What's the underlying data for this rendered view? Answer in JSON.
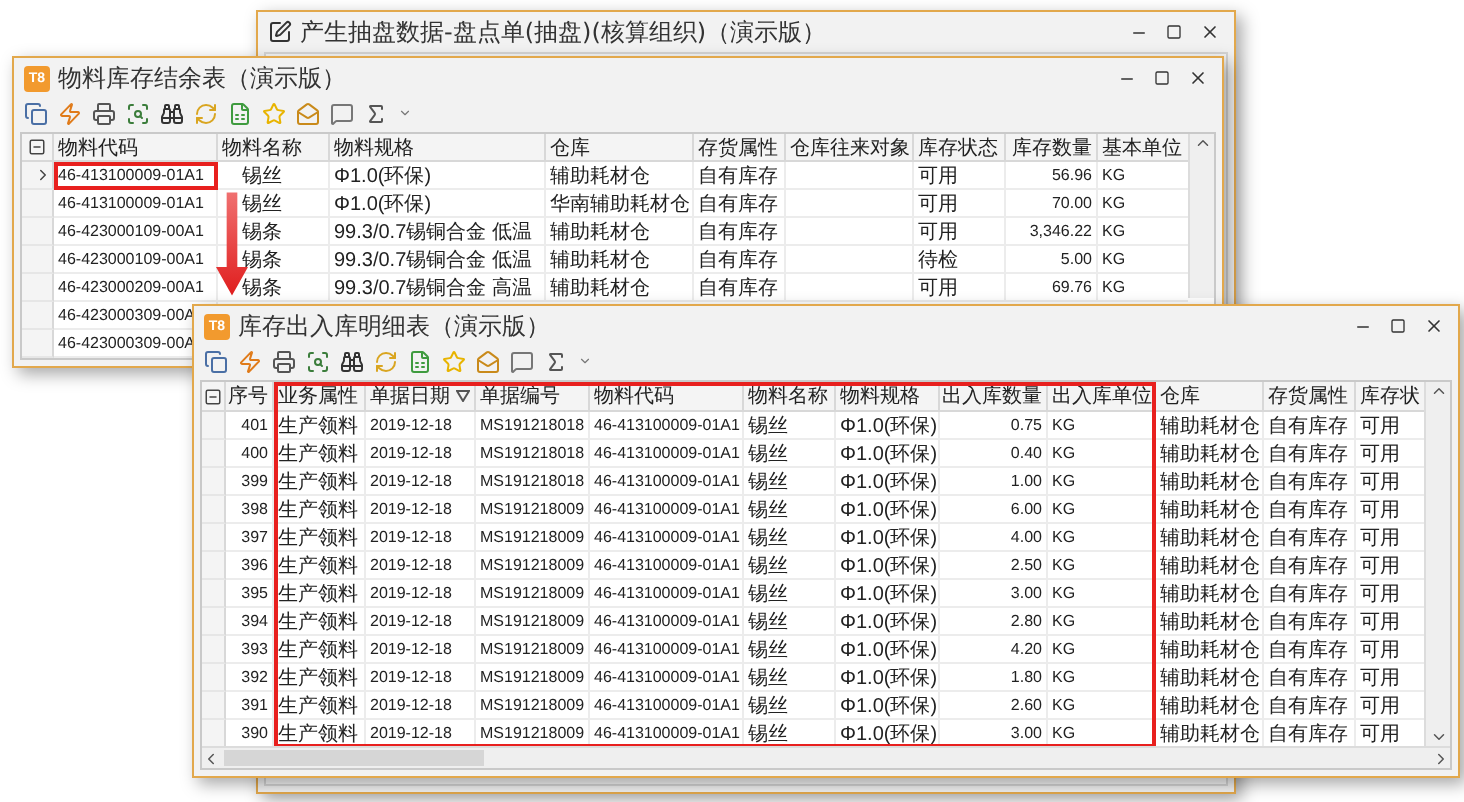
{
  "back_window": {
    "title": "产生抽盘数据-盘点单(抽盘)(核算组织)（演示版）"
  },
  "stock_window": {
    "badge": "T8",
    "title": "物料库存结余表（演示版）",
    "columns": [
      "物料代码",
      "物料名称",
      "物料规格",
      "仓库",
      "存货属性",
      "仓库往来对象",
      "库存状态",
      "库存数量",
      "基本单位"
    ],
    "rows": [
      {
        "current": true,
        "marked": true,
        "cells": [
          "46-413100009-01A1",
          "锡丝",
          "Φ1.0(环保)",
          "辅助耗材仓",
          "自有库存",
          "",
          "可用",
          "56.96",
          "KG"
        ]
      },
      {
        "current": false,
        "marked": false,
        "cells": [
          "46-413100009-01A1",
          "锡丝",
          "Φ1.0(环保)",
          "华南辅助耗材仓",
          "自有库存",
          "",
          "可用",
          "70.00",
          "KG"
        ]
      },
      {
        "current": false,
        "marked": false,
        "cells": [
          "46-423000109-00A1",
          "锡条",
          "99.3/0.7锡铜合金 低温",
          "辅助耗材仓",
          "自有库存",
          "",
          "可用",
          "3,346.22",
          "KG"
        ]
      },
      {
        "current": false,
        "marked": false,
        "cells": [
          "46-423000109-00A1",
          "锡条",
          "99.3/0.7锡铜合金 低温",
          "辅助耗材仓",
          "自有库存",
          "",
          "待检",
          "5.00",
          "KG"
        ]
      },
      {
        "current": false,
        "marked": false,
        "cells": [
          "46-423000209-00A1",
          "锡条",
          "99.3/0.7锡铜合金 高温",
          "辅助耗材仓",
          "自有库存",
          "",
          "可用",
          "69.76",
          "KG"
        ]
      },
      {
        "current": false,
        "marked": false,
        "cells": [
          "46-423000309-00A"
        ]
      },
      {
        "current": false,
        "marked": false,
        "cells": [
          "46-423000309-00A"
        ]
      }
    ]
  },
  "detail_window": {
    "badge": "T8",
    "title": "库存出入库明细表（演示版）",
    "framed": true,
    "columns": [
      {
        "label": "序号",
        "sorted": false
      },
      {
        "label": "业务属性",
        "sorted": false
      },
      {
        "label": "单据日期",
        "sorted": true
      },
      {
        "label": "单据编号",
        "sorted": false
      },
      {
        "label": "物料代码",
        "sorted": false
      },
      {
        "label": "物料名称",
        "sorted": false
      },
      {
        "label": "物料规格",
        "sorted": false
      },
      {
        "label": "出入库数量",
        "sorted": false
      },
      {
        "label": "出入库单位",
        "sorted": false
      },
      {
        "label": "仓库",
        "sorted": false
      },
      {
        "label": "存货属性",
        "sorted": false
      },
      {
        "label": "库存状",
        "sorted": false
      }
    ],
    "rows": [
      [
        "401",
        "生产领料",
        "2019-12-18",
        "MS191218018",
        "46-413100009-01A1",
        "锡丝",
        "Φ1.0(环保)",
        "0.75",
        "KG",
        "辅助耗材仓",
        "自有库存",
        "可用"
      ],
      [
        "400",
        "生产领料",
        "2019-12-18",
        "MS191218018",
        "46-413100009-01A1",
        "锡丝",
        "Φ1.0(环保)",
        "0.40",
        "KG",
        "辅助耗材仓",
        "自有库存",
        "可用"
      ],
      [
        "399",
        "生产领料",
        "2019-12-18",
        "MS191218018",
        "46-413100009-01A1",
        "锡丝",
        "Φ1.0(环保)",
        "1.00",
        "KG",
        "辅助耗材仓",
        "自有库存",
        "可用"
      ],
      [
        "398",
        "生产领料",
        "2019-12-18",
        "MS191218009",
        "46-413100009-01A1",
        "锡丝",
        "Φ1.0(环保)",
        "6.00",
        "KG",
        "辅助耗材仓",
        "自有库存",
        "可用"
      ],
      [
        "397",
        "生产领料",
        "2019-12-18",
        "MS191218009",
        "46-413100009-01A1",
        "锡丝",
        "Φ1.0(环保)",
        "4.00",
        "KG",
        "辅助耗材仓",
        "自有库存",
        "可用"
      ],
      [
        "396",
        "生产领料",
        "2019-12-18",
        "MS191218009",
        "46-413100009-01A1",
        "锡丝",
        "Φ1.0(环保)",
        "2.50",
        "KG",
        "辅助耗材仓",
        "自有库存",
        "可用"
      ],
      [
        "395",
        "生产领料",
        "2019-12-18",
        "MS191218009",
        "46-413100009-01A1",
        "锡丝",
        "Φ1.0(环保)",
        "3.00",
        "KG",
        "辅助耗材仓",
        "自有库存",
        "可用"
      ],
      [
        "394",
        "生产领料",
        "2019-12-18",
        "MS191218009",
        "46-413100009-01A1",
        "锡丝",
        "Φ1.0(环保)",
        "2.80",
        "KG",
        "辅助耗材仓",
        "自有库存",
        "可用"
      ],
      [
        "393",
        "生产领料",
        "2019-12-18",
        "MS191218009",
        "46-413100009-01A1",
        "锡丝",
        "Φ1.0(环保)",
        "4.20",
        "KG",
        "辅助耗材仓",
        "自有库存",
        "可用"
      ],
      [
        "392",
        "生产领料",
        "2019-12-18",
        "MS191218009",
        "46-413100009-01A1",
        "锡丝",
        "Φ1.0(环保)",
        "1.80",
        "KG",
        "辅助耗材仓",
        "自有库存",
        "可用"
      ],
      [
        "391",
        "生产领料",
        "2019-12-18",
        "MS191218009",
        "46-413100009-01A1",
        "锡丝",
        "Φ1.0(环保)",
        "2.60",
        "KG",
        "辅助耗材仓",
        "自有库存",
        "可用"
      ],
      [
        "390",
        "生产领料",
        "2019-12-18",
        "MS191218009",
        "46-413100009-01A1",
        "锡丝",
        "Φ1.0(环保)",
        "3.00",
        "KG",
        "辅助耗材仓",
        "自有库存",
        "可用"
      ]
    ]
  }
}
